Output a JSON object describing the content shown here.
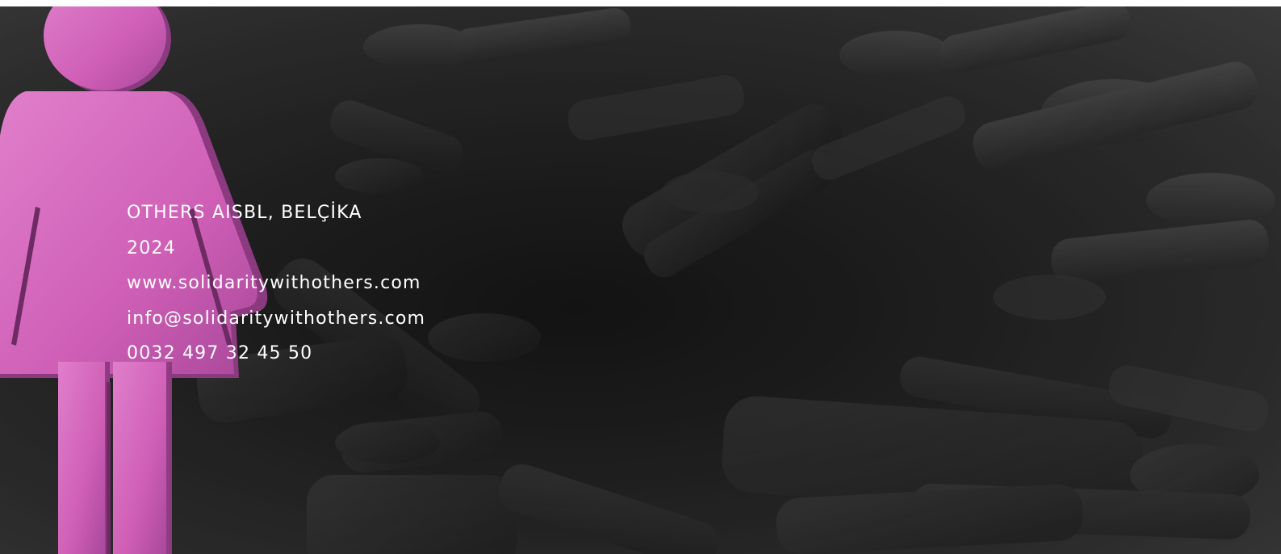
{
  "hero": {
    "background_icon": "people-figures-pattern",
    "accent_icon": "woman-figure-icon",
    "accent_color": "#d867b8",
    "background_color": "#2a2a2a"
  },
  "contact": {
    "organization": "OTHERS AISBL, BELÇİKA",
    "year": "2024",
    "website": "www.solidaritywithothers.com",
    "email": "info@solidaritywithothers.com",
    "phone": "0032 497 32 45 50"
  }
}
